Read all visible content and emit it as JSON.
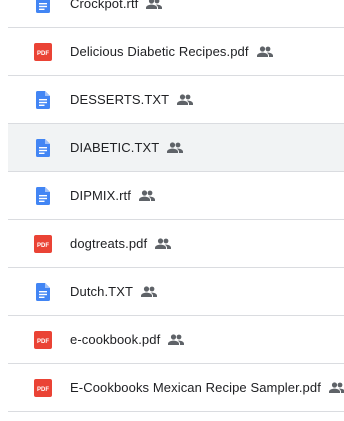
{
  "files": [
    {
      "name": "Crockpot.rtf",
      "type": "doc",
      "icon": "docs-icon",
      "shared": true,
      "highlighted": false
    },
    {
      "name": "Delicious Diabetic Recipes.pdf",
      "type": "pdf",
      "icon": "pdf-icon",
      "shared": true,
      "highlighted": false
    },
    {
      "name": "DESSERTS.TXT",
      "type": "doc",
      "icon": "docs-icon",
      "shared": true,
      "highlighted": false
    },
    {
      "name": "DIABETIC.TXT",
      "type": "doc",
      "icon": "docs-icon",
      "shared": true,
      "highlighted": true
    },
    {
      "name": "DIPMIX.rtf",
      "type": "doc",
      "icon": "docs-icon",
      "shared": true,
      "highlighted": false
    },
    {
      "name": "dogtreats.pdf",
      "type": "pdf",
      "icon": "pdf-icon",
      "shared": true,
      "highlighted": false
    },
    {
      "name": "Dutch.TXT",
      "type": "doc",
      "icon": "docs-icon",
      "shared": true,
      "highlighted": false
    },
    {
      "name": "e-cookbook.pdf",
      "type": "pdf",
      "icon": "pdf-icon",
      "shared": true,
      "highlighted": false
    },
    {
      "name": "E-Cookbooks Mexican Recipe Sampler.pdf",
      "type": "pdf",
      "icon": "pdf-icon",
      "shared": true,
      "highlighted": false
    }
  ],
  "pdf_badge_text": "PDF",
  "colors": {
    "doc_blue": "#4285f4",
    "pdf_red": "#ea4335",
    "text": "#202124",
    "shared_icon": "#5f6368",
    "highlight_bg": "#f1f3f4",
    "divider": "#dadce0"
  }
}
